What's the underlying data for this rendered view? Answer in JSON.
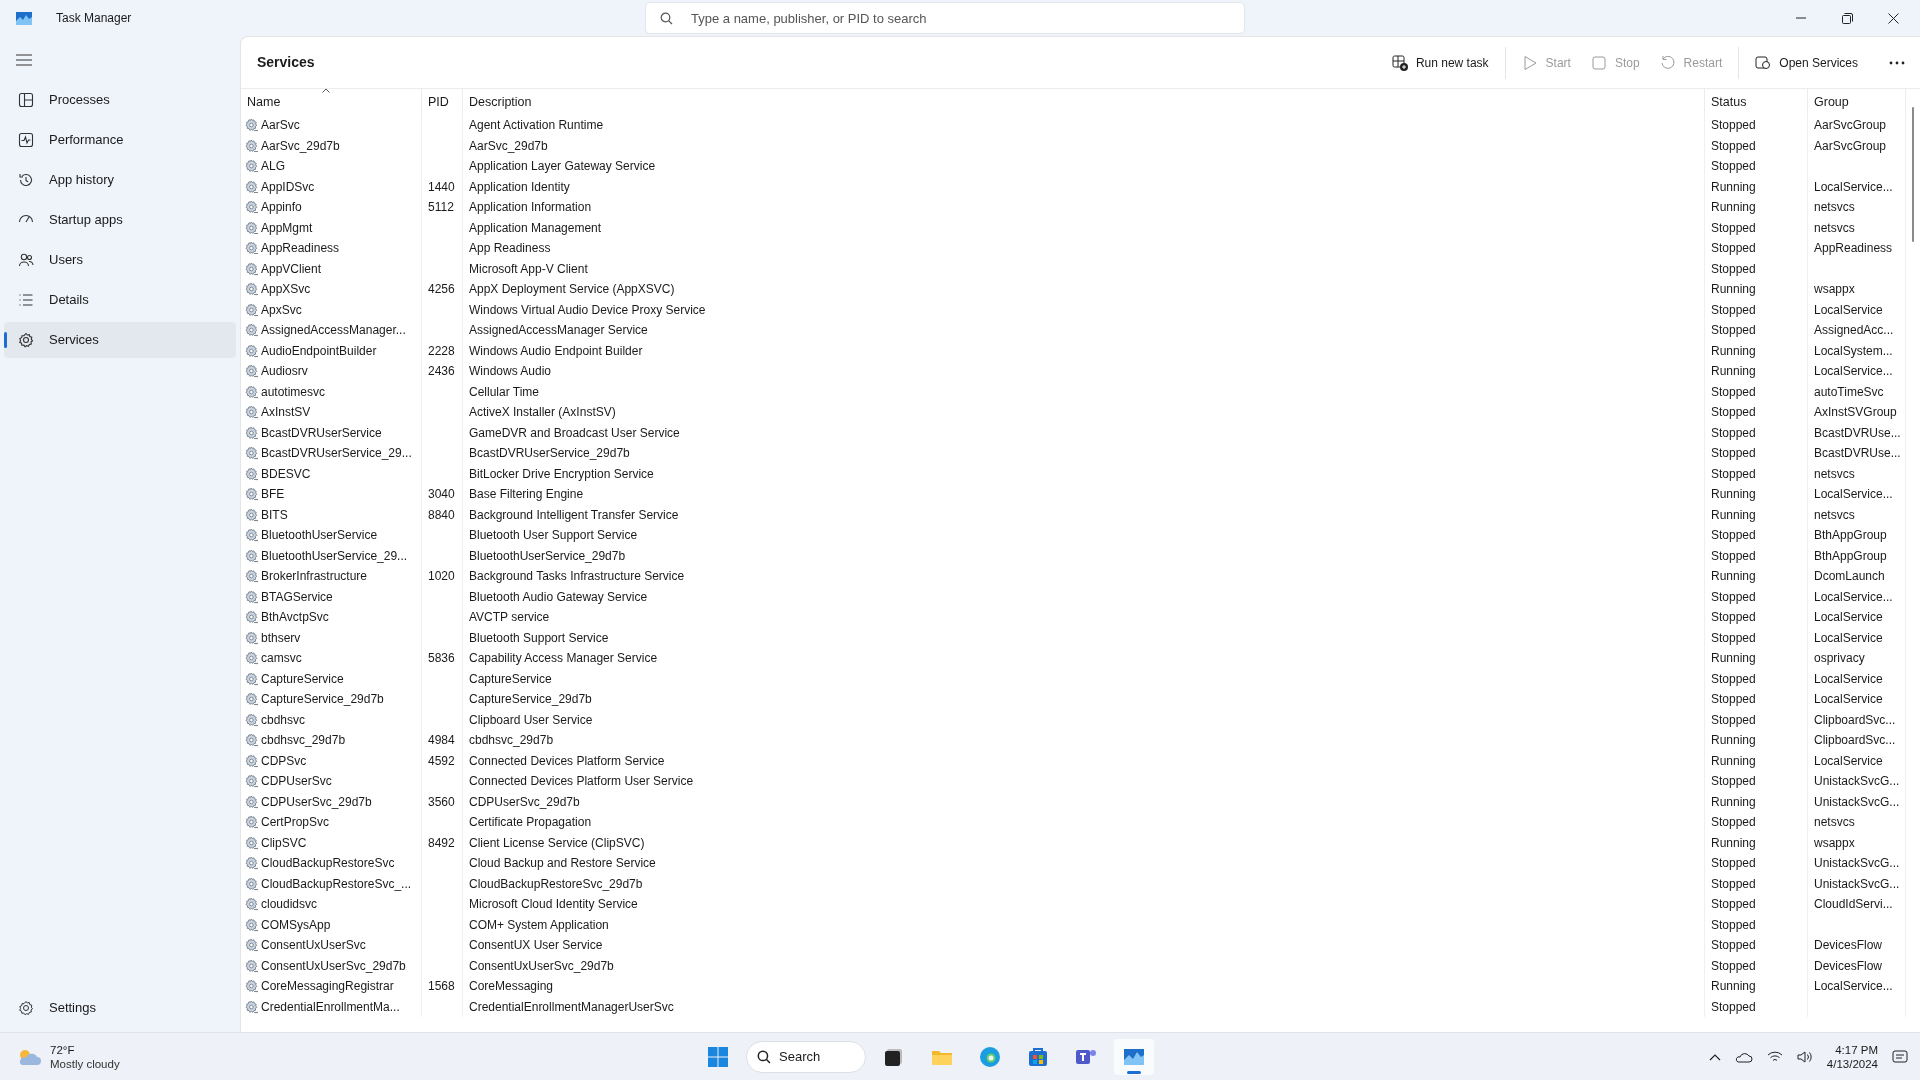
{
  "window": {
    "title": "Task Manager"
  },
  "search": {
    "placeholder": "Type a name, publisher, or PID to search"
  },
  "sidebar": {
    "items": [
      {
        "label": "Processes",
        "selected": false
      },
      {
        "label": "Performance",
        "selected": false
      },
      {
        "label": "App history",
        "selected": false
      },
      {
        "label": "Startup apps",
        "selected": false
      },
      {
        "label": "Users",
        "selected": false
      },
      {
        "label": "Details",
        "selected": false
      },
      {
        "label": "Services",
        "selected": true
      }
    ],
    "settings": "Settings"
  },
  "page_title": "Services",
  "toolbar": [
    {
      "label": "Run new task",
      "disabled": false
    },
    {
      "label": "Start",
      "disabled": true
    },
    {
      "label": "Stop",
      "disabled": true
    },
    {
      "label": "Restart",
      "disabled": true
    },
    {
      "label": "Open Services",
      "disabled": false
    }
  ],
  "table": {
    "columns": [
      "Name",
      "PID",
      "Description",
      "Status",
      "Group"
    ],
    "rows": [
      {
        "name": "AarSvc",
        "pid": "",
        "description": "Agent Activation Runtime",
        "status": "Stopped",
        "group": "AarSvcGroup"
      },
      {
        "name": "AarSvc_29d7b",
        "pid": "",
        "description": "AarSvc_29d7b",
        "status": "Stopped",
        "group": "AarSvcGroup"
      },
      {
        "name": "ALG",
        "pid": "",
        "description": "Application Layer Gateway Service",
        "status": "Stopped",
        "group": ""
      },
      {
        "name": "AppIDSvc",
        "pid": "1440",
        "description": "Application Identity",
        "status": "Running",
        "group": "LocalService..."
      },
      {
        "name": "Appinfo",
        "pid": "5112",
        "description": "Application Information",
        "status": "Running",
        "group": "netsvcs"
      },
      {
        "name": "AppMgmt",
        "pid": "",
        "description": "Application Management",
        "status": "Stopped",
        "group": "netsvcs"
      },
      {
        "name": "AppReadiness",
        "pid": "",
        "description": "App Readiness",
        "status": "Stopped",
        "group": "AppReadiness"
      },
      {
        "name": "AppVClient",
        "pid": "",
        "description": "Microsoft App-V Client",
        "status": "Stopped",
        "group": ""
      },
      {
        "name": "AppXSvc",
        "pid": "4256",
        "description": "AppX Deployment Service (AppXSVC)",
        "status": "Running",
        "group": "wsappx"
      },
      {
        "name": "ApxSvc",
        "pid": "",
        "description": "Windows Virtual Audio Device Proxy Service",
        "status": "Stopped",
        "group": "LocalService"
      },
      {
        "name": "AssignedAccessManager...",
        "pid": "",
        "description": "AssignedAccessManager Service",
        "status": "Stopped",
        "group": "AssignedAcc..."
      },
      {
        "name": "AudioEndpointBuilder",
        "pid": "2228",
        "description": "Windows Audio Endpoint Builder",
        "status": "Running",
        "group": "LocalSystem..."
      },
      {
        "name": "Audiosrv",
        "pid": "2436",
        "description": "Windows Audio",
        "status": "Running",
        "group": "LocalService..."
      },
      {
        "name": "autotimesvc",
        "pid": "",
        "description": "Cellular Time",
        "status": "Stopped",
        "group": "autoTimeSvc"
      },
      {
        "name": "AxInstSV",
        "pid": "",
        "description": "ActiveX Installer (AxInstSV)",
        "status": "Stopped",
        "group": "AxInstSVGroup"
      },
      {
        "name": "BcastDVRUserService",
        "pid": "",
        "description": "GameDVR and Broadcast User Service",
        "status": "Stopped",
        "group": "BcastDVRUse..."
      },
      {
        "name": "BcastDVRUserService_29...",
        "pid": "",
        "description": "BcastDVRUserService_29d7b",
        "status": "Stopped",
        "group": "BcastDVRUse..."
      },
      {
        "name": "BDESVC",
        "pid": "",
        "description": "BitLocker Drive Encryption Service",
        "status": "Stopped",
        "group": "netsvcs"
      },
      {
        "name": "BFE",
        "pid": "3040",
        "description": "Base Filtering Engine",
        "status": "Running",
        "group": "LocalService..."
      },
      {
        "name": "BITS",
        "pid": "8840",
        "description": "Background Intelligent Transfer Service",
        "status": "Running",
        "group": "netsvcs"
      },
      {
        "name": "BluetoothUserService",
        "pid": "",
        "description": "Bluetooth User Support Service",
        "status": "Stopped",
        "group": "BthAppGroup"
      },
      {
        "name": "BluetoothUserService_29...",
        "pid": "",
        "description": "BluetoothUserService_29d7b",
        "status": "Stopped",
        "group": "BthAppGroup"
      },
      {
        "name": "BrokerInfrastructure",
        "pid": "1020",
        "description": "Background Tasks Infrastructure Service",
        "status": "Running",
        "group": "DcomLaunch"
      },
      {
        "name": "BTAGService",
        "pid": "",
        "description": "Bluetooth Audio Gateway Service",
        "status": "Stopped",
        "group": "LocalService..."
      },
      {
        "name": "BthAvctpSvc",
        "pid": "",
        "description": "AVCTP service",
        "status": "Stopped",
        "group": "LocalService"
      },
      {
        "name": "bthserv",
        "pid": "",
        "description": "Bluetooth Support Service",
        "status": "Stopped",
        "group": "LocalService"
      },
      {
        "name": "camsvc",
        "pid": "5836",
        "description": "Capability Access Manager Service",
        "status": "Running",
        "group": "osprivacy"
      },
      {
        "name": "CaptureService",
        "pid": "",
        "description": "CaptureService",
        "status": "Stopped",
        "group": "LocalService"
      },
      {
        "name": "CaptureService_29d7b",
        "pid": "",
        "description": "CaptureService_29d7b",
        "status": "Stopped",
        "group": "LocalService"
      },
      {
        "name": "cbdhsvc",
        "pid": "",
        "description": "Clipboard User Service",
        "status": "Stopped",
        "group": "ClipboardSvc..."
      },
      {
        "name": "cbdhsvc_29d7b",
        "pid": "4984",
        "description": "cbdhsvc_29d7b",
        "status": "Running",
        "group": "ClipboardSvc..."
      },
      {
        "name": "CDPSvc",
        "pid": "4592",
        "description": "Connected Devices Platform Service",
        "status": "Running",
        "group": "LocalService"
      },
      {
        "name": "CDPUserSvc",
        "pid": "",
        "description": "Connected Devices Platform User Service",
        "status": "Stopped",
        "group": "UnistackSvcG..."
      },
      {
        "name": "CDPUserSvc_29d7b",
        "pid": "3560",
        "description": "CDPUserSvc_29d7b",
        "status": "Running",
        "group": "UnistackSvcG..."
      },
      {
        "name": "CertPropSvc",
        "pid": "",
        "description": "Certificate Propagation",
        "status": "Stopped",
        "group": "netsvcs"
      },
      {
        "name": "ClipSVC",
        "pid": "8492",
        "description": "Client License Service (ClipSVC)",
        "status": "Running",
        "group": "wsappx"
      },
      {
        "name": "CloudBackupRestoreSvc",
        "pid": "",
        "description": "Cloud Backup and Restore Service",
        "status": "Stopped",
        "group": "UnistackSvcG..."
      },
      {
        "name": "CloudBackupRestoreSvc_...",
        "pid": "",
        "description": "CloudBackupRestoreSvc_29d7b",
        "status": "Stopped",
        "group": "UnistackSvcG..."
      },
      {
        "name": "cloudidsvc",
        "pid": "",
        "description": "Microsoft Cloud Identity Service",
        "status": "Stopped",
        "group": "CloudIdServi..."
      },
      {
        "name": "COMSysApp",
        "pid": "",
        "description": "COM+ System Application",
        "status": "Stopped",
        "group": ""
      },
      {
        "name": "ConsentUxUserSvc",
        "pid": "",
        "description": "ConsentUX User Service",
        "status": "Stopped",
        "group": "DevicesFlow"
      },
      {
        "name": "ConsentUxUserSvc_29d7b",
        "pid": "",
        "description": "ConsentUxUserSvc_29d7b",
        "status": "Stopped",
        "group": "DevicesFlow"
      },
      {
        "name": "CoreMessagingRegistrar",
        "pid": "1568",
        "description": "CoreMessaging",
        "status": "Running",
        "group": "LocalService..."
      },
      {
        "name": "CredentialEnrollmentMa...",
        "pid": "",
        "description": "CredentialEnrollmentManagerUserSvc",
        "status": "Stopped",
        "group": ""
      }
    ]
  },
  "taskbar": {
    "weather": {
      "temperature": "72°F",
      "condition": "Mostly cloudy"
    },
    "search": "Search",
    "apps": [
      {
        "active": false
      },
      {
        "active": false
      },
      {
        "active": false
      },
      {
        "active": false
      },
      {
        "active": false
      },
      {
        "active": false
      },
      {
        "active": true
      }
    ],
    "time": "4:17 PM",
    "date": "4/13/2024"
  }
}
